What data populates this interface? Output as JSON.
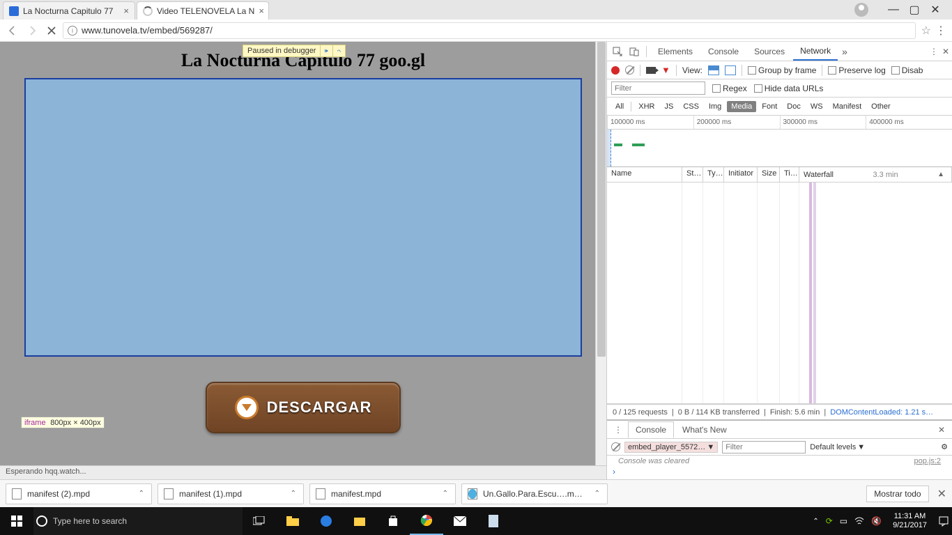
{
  "window": {
    "min": "—",
    "max": "▢",
    "close": "✕"
  },
  "tabs": [
    {
      "title": "La Nocturna Capitulo 77",
      "active": false
    },
    {
      "title": "Video TELENOVELA La N",
      "active": true
    }
  ],
  "url": "www.tunovela.tv/embed/569287/",
  "debugger": {
    "msg": "Paused in debugger"
  },
  "page": {
    "heading": "La Nocturna Capitulo 77 goo.gl",
    "iframe_tooltip_tag": "iframe",
    "iframe_tooltip_dim": "800px × 400px",
    "download_label": "DESCARGAR"
  },
  "status_bar": "Esperando hqq.watch...",
  "devtools": {
    "tabs": {
      "elements": "Elements",
      "console": "Console",
      "sources": "Sources",
      "network": "Network"
    },
    "toolbar": {
      "view": "View:",
      "group": "Group by frame",
      "preserve": "Preserve log",
      "disable": "Disab"
    },
    "filter": {
      "placeholder": "Filter",
      "regex": "Regex",
      "hide": "Hide data URLs"
    },
    "types": {
      "all": "All",
      "xhr": "XHR",
      "js": "JS",
      "css": "CSS",
      "img": "Img",
      "media": "Media",
      "font": "Font",
      "doc": "Doc",
      "ws": "WS",
      "manifest": "Manifest",
      "other": "Other"
    },
    "ruler": [
      "100000 ms",
      "200000 ms",
      "300000 ms",
      "400000 ms"
    ],
    "headers": {
      "name": "Name",
      "status": "St…",
      "type": "Ty…",
      "initiator": "Initiator",
      "size": "Size",
      "time": "Ti…",
      "waterfall": "Waterfall",
      "span": "3.3 min"
    },
    "status": {
      "req": "0 / 125 requests",
      "xfer": "0 B / 114 KB transferred",
      "finish": "Finish: 5.6 min",
      "dcl": "DOMContentLoaded: 1.21 s…"
    },
    "drawer": {
      "tabs": {
        "console": "Console",
        "whatsnew": "What's New"
      },
      "context": "embed_player_5572…",
      "filter_placeholder": "Filter",
      "levels": "Default levels",
      "cleared": "Console was cleared",
      "source": "pop.js:2"
    }
  },
  "downloads": {
    "items": [
      "manifest (2).mpd",
      "manifest (1).mpd",
      "manifest.mpd",
      "Un.Gallo.Para.Escu….m…"
    ],
    "show_all": "Mostrar todo"
  },
  "taskbar": {
    "search_placeholder": "Type here to search",
    "time": "11:31 AM",
    "date": "9/21/2017"
  }
}
